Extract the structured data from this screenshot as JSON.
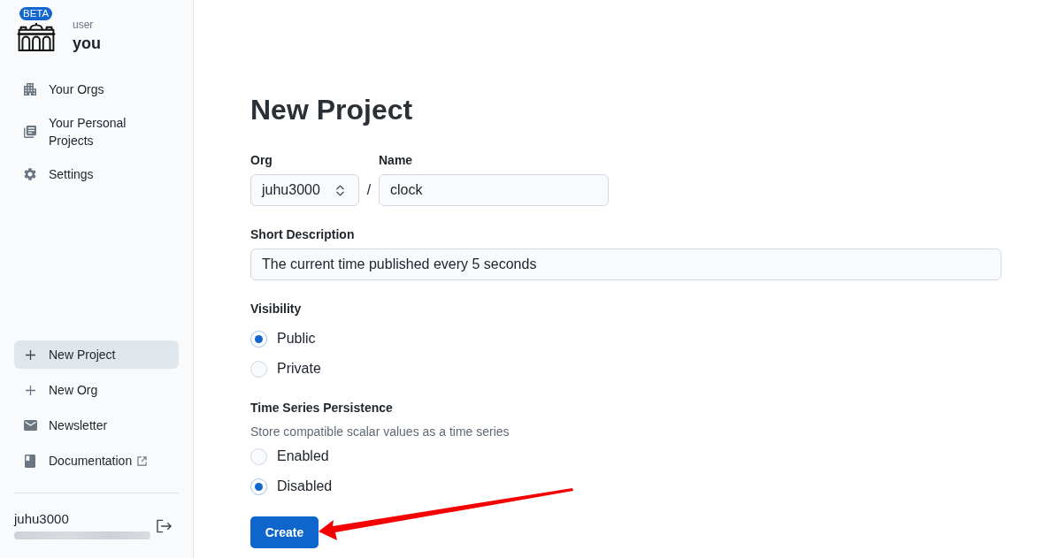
{
  "sidebar": {
    "badge": "BETA",
    "user_label": "user",
    "username": "you",
    "nav": [
      {
        "label": "Your Orgs",
        "selected": false
      },
      {
        "label": "Your Personal Projects",
        "selected": false
      },
      {
        "label": "Settings",
        "selected": false
      }
    ],
    "actions": [
      {
        "label": "New Project",
        "selected": true,
        "external": false
      },
      {
        "label": "New Org",
        "selected": false,
        "external": false
      },
      {
        "label": "Newsletter",
        "selected": false,
        "external": false
      },
      {
        "label": "Documentation",
        "selected": false,
        "external": true
      }
    ],
    "account": {
      "name": "juhu3000"
    }
  },
  "form": {
    "title": "New Project",
    "org": {
      "label": "Org",
      "value": "juhu3000"
    },
    "separator": "/",
    "name": {
      "label": "Name",
      "value": "clock"
    },
    "description": {
      "label": "Short Description",
      "value": "The current time published every 5 seconds"
    },
    "visibility": {
      "label": "Visibility",
      "options": [
        {
          "label": "Public",
          "selected": true
        },
        {
          "label": "Private",
          "selected": false
        }
      ]
    },
    "persistence": {
      "label": "Time Series Persistence",
      "hint": "Store compatible scalar values as a time series",
      "options": [
        {
          "label": "Enabled",
          "selected": false
        },
        {
          "label": "Disabled",
          "selected": true
        }
      ]
    },
    "submit": "Create"
  }
}
